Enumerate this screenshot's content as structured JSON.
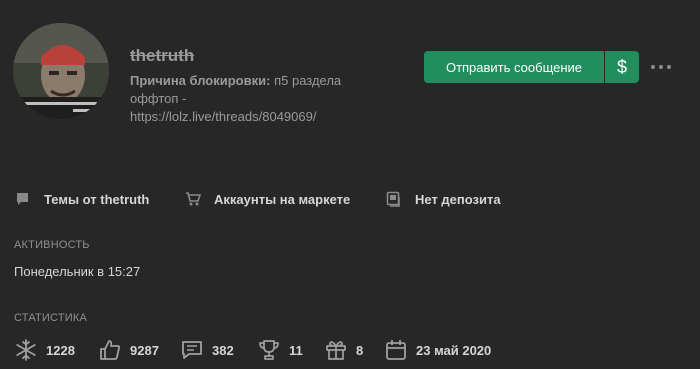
{
  "profile": {
    "username": "thetruth",
    "ban_label": "Причина блокировки:",
    "ban_reason": "п5 раздела оффтоп - https://lolz.live/threads/8049069/",
    "avatar_icon": "avatar-photo"
  },
  "actions": {
    "send_message": "Отправить сообщение",
    "pay_symbol": "$",
    "more_icon": "ellipsis-icon"
  },
  "links": [
    {
      "label": "Темы от thetruth",
      "icon": "comment-icon"
    },
    {
      "label": "Аккаунты на маркете",
      "icon": "cart-icon"
    },
    {
      "label": "Нет депозита",
      "icon": "deposit-icon"
    }
  ],
  "activity": {
    "title": "Активность",
    "last_seen": "Понедельник в 15:27"
  },
  "statistics": {
    "title": "Статистика",
    "items": [
      {
        "icon": "snowflake-icon",
        "value": "1228"
      },
      {
        "icon": "like-icon",
        "value": "9287"
      },
      {
        "icon": "messages-icon",
        "value": "382"
      },
      {
        "icon": "trophy-icon",
        "value": "11"
      },
      {
        "icon": "gift-icon",
        "value": "8"
      },
      {
        "icon": "calendar-icon",
        "value": "23 май 2020"
      }
    ]
  },
  "colors": {
    "background": "#272727",
    "accent_button": "#228e5d",
    "muted_text": "#9a9a9a",
    "text": "#d6d6d6"
  }
}
